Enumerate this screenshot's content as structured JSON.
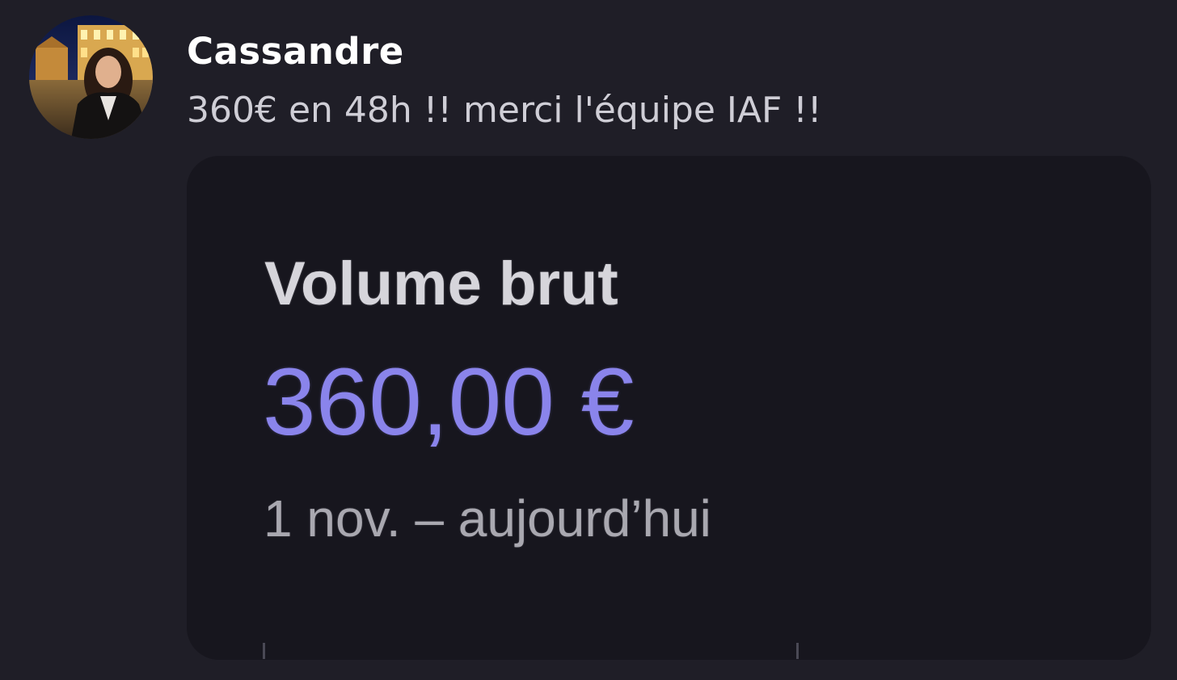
{
  "post": {
    "author": "Cassandre",
    "text": "360€ en 48h !! merci l'équipe IAF !!"
  },
  "media": {
    "title": "Volume brut",
    "amount": "360,00 €",
    "period": "1 nov. – aujourd’hui"
  },
  "colors": {
    "background": "#1f1e27",
    "card_background": "#17161e",
    "amount_accent": "#8a84eb",
    "author_text": "#ffffff",
    "body_text": "#cfced6"
  }
}
